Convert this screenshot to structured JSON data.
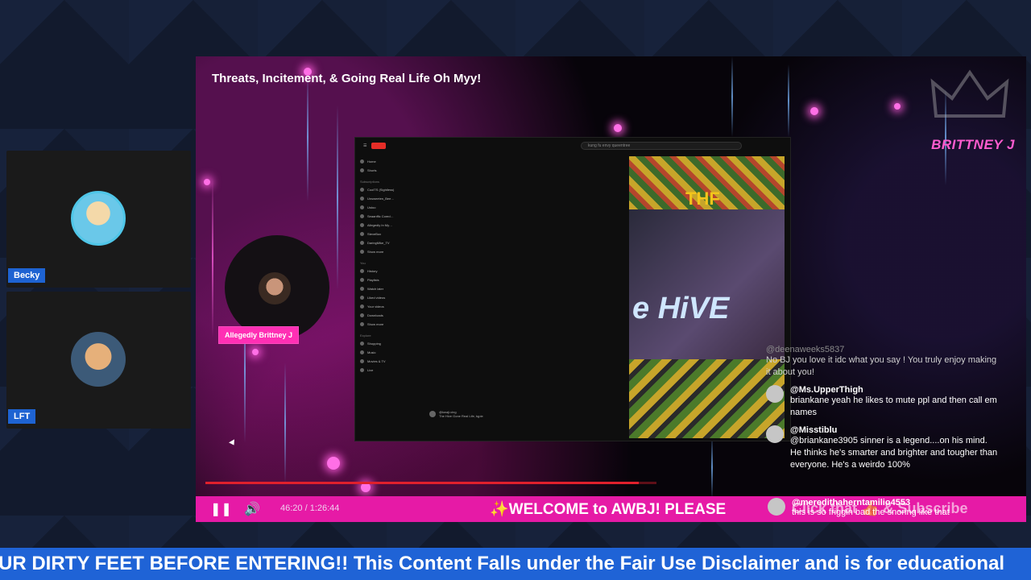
{
  "participants": [
    {
      "name": "Becky"
    },
    {
      "name": "LFT"
    }
  ],
  "stage": {
    "title": "Threats, Incitement, & Going Real Life Oh Myy!",
    "brand_name": "BRITTNEY J",
    "host_label": "Allegedly Brittney J",
    "player": {
      "time": "46:20 / 1:26:44",
      "marquee": "✨WELCOME to AWBJ! PLEASE",
      "cta": "Click that 👍 & Subscribe"
    }
  },
  "embedded_browser": {
    "search_text": "kung fu envy queentree",
    "sidebar": {
      "top": [
        "Home",
        "Shorts"
      ],
      "subscriptions_header": "Subscriptions",
      "subscriptions": [
        "CoolTS (Sightless)",
        "Unsweeten_Bee…",
        "Ustoo",
        "Seaanffic Cored…",
        "Allegedly In My…",
        "SteveBox",
        "DaringMike_TV",
        "Show more"
      ],
      "you_header": "You",
      "you": [
        "History",
        "Playlists",
        "Watch later",
        "Liked videos",
        "Your videos",
        "Downloads",
        "Show more"
      ],
      "explore_header": "Explore",
      "explore": [
        "Shopping",
        "Music",
        "Movies & TV",
        "Live"
      ]
    },
    "comment_user": "@kwaji-ving",
    "comment_text": "The Hive Gone Real Life, tqpie",
    "short": {
      "top_text": "THF",
      "hive_text": "e HiVE"
    }
  },
  "chat": [
    {
      "user": "@deenaweeks5837",
      "text": "No BJ you love it idc what you say ! You truly enjoy making it about you!",
      "faded": true
    },
    {
      "user": "@Ms.UpperThigh",
      "text": "briankane yeah he likes to mute ppl and then call em names",
      "faded": false
    },
    {
      "user": "@Misstiblu",
      "text": "@briankane3905 sinner is a legend....on his mind. He thinks he's smarter and brighter and tougher than everyone. He's a weirdo 100%",
      "faded": false
    },
    {
      "user": "@meredithaherntamilio4553",
      "text": "this is so friggin bad the snoring like that",
      "faded": false
    }
  ],
  "ticker": {
    "text": "UR DIRTY FEET BEFORE ENTERING!! This Content Falls under the Fair Use Disclaimer and is for educational"
  },
  "colors": {
    "ticker_bg": "#1f63d6",
    "control_bar": "#e61aa6",
    "name_tag": "#1e63d2",
    "brand_pink": "#ff5ccf"
  }
}
